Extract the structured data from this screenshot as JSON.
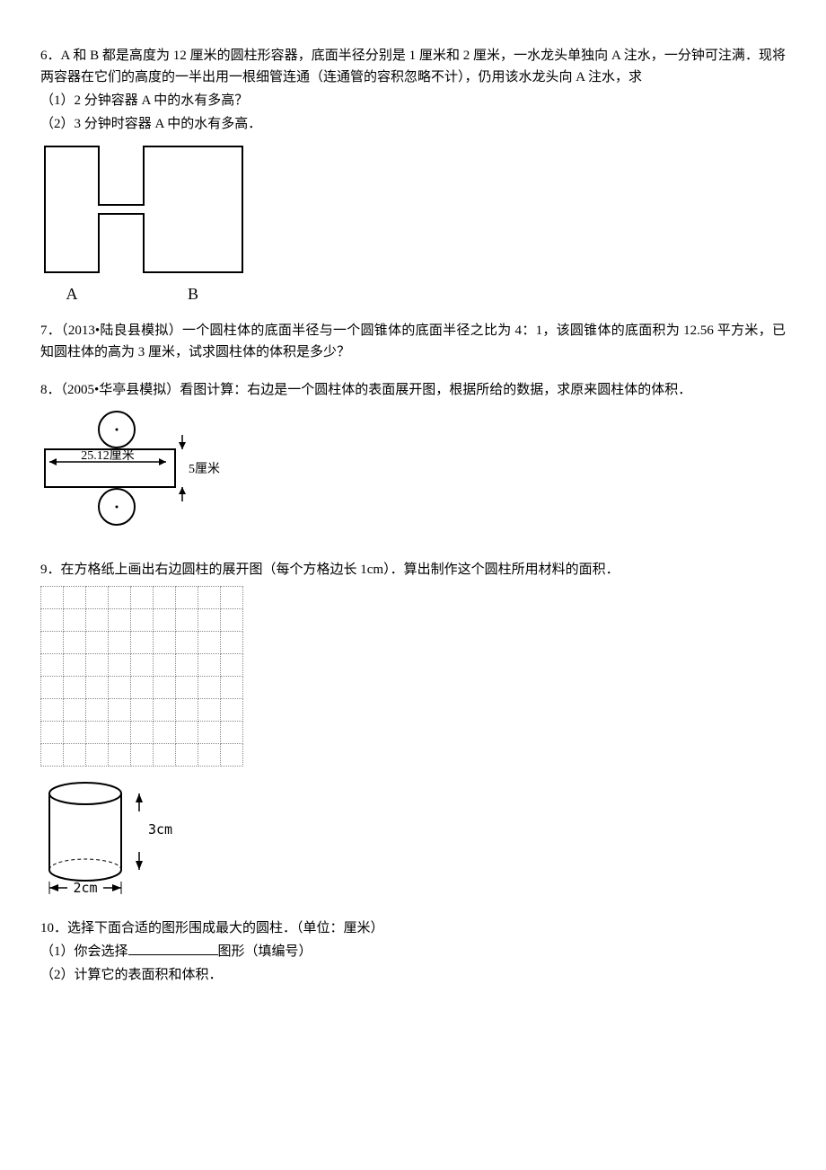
{
  "q6": {
    "num": "6．",
    "text": "A 和 B 都是高度为 12 厘米的圆柱形容器，底面半径分别是 1 厘米和 2 厘米，一水龙头单独向 A 注水，一分钟可注满．现将两容器在它们的高度的一半出用一根细管连通（连通管的容积忽略不计），仍用该水龙头向 A 注水，求",
    "sub1": "（1）2 分钟容器 A 中的水有多高？",
    "sub2": "（2）3 分钟时容器 A 中的水有多高．",
    "labelA": "A",
    "labelB": "B"
  },
  "q7": {
    "num": "7．",
    "text": "（2013•陆良县模拟）一个圆柱体的底面半径与一个圆锥体的底面半径之比为 4：1，该圆锥体的底面积为 12.56 平方米，已知圆柱体的高为 3 厘米，试求圆柱体的体积是多少？"
  },
  "q8": {
    "num": "8．",
    "text": "（2005•华亭县模拟）看图计算：右边是一个圆柱体的表面展开图，根据所给的数据，求原来圆柱体的体积．",
    "dim1": "25.12厘米",
    "dim2": "5厘米"
  },
  "q9": {
    "num": "9．",
    "text": "在方格纸上画出右边圆柱的展开图（每个方格边长 1cm）．算出制作这个圆柱所用材料的面积．",
    "dimH": "3cm",
    "dimW": "2cm"
  },
  "q10": {
    "num": "10．",
    "text": "选择下面合适的图形围成最大的圆柱．（单位：厘米）",
    "sub1a": "（1）你会选择",
    "sub1b": "图形（填编号）",
    "sub2": "（2）计算它的表面积和体积．"
  }
}
